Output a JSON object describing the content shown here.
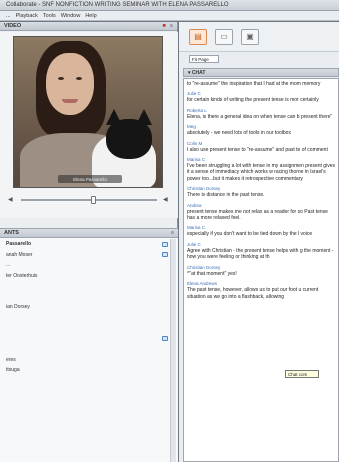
{
  "window": {
    "title": "Collaborate - SNF NONFICTION WRITING SEMINAR WITH ELENA PASSARELLO"
  },
  "menu": {
    "items": [
      "...",
      "Playback",
      "Tools",
      "Window",
      "Help"
    ]
  },
  "video_panel": {
    "title": "VIDEO",
    "caption": "Elena Passarello"
  },
  "attendees_panel": {
    "title": "ANTS",
    "rows": [
      {
        "name": "Passarello",
        "bold": true,
        "status": true
      },
      {
        "name": "anah Moser",
        "bold": false,
        "status": true
      },
      {
        "name": "...",
        "bold": false,
        "status": false
      },
      {
        "name": "ter Oosterhuis",
        "bold": false,
        "status": false
      },
      {
        "name": "",
        "bold": false,
        "status": false
      },
      {
        "name": "",
        "bold": false,
        "status": false
      },
      {
        "name": "ian Dorsey",
        "bold": false,
        "status": false
      },
      {
        "name": "",
        "bold": false,
        "status": false
      },
      {
        "name": "",
        "bold": false,
        "status": false
      },
      {
        "name": "",
        "bold": false,
        "status": true
      },
      {
        "name": "",
        "bold": false,
        "status": false
      },
      {
        "name": "eres",
        "bold": false,
        "status": false
      },
      {
        "name": "ttsuga",
        "bold": false,
        "status": false
      },
      {
        "name": "",
        "bold": false,
        "status": false
      },
      {
        "name": "",
        "bold": false,
        "status": false
      }
    ]
  },
  "toolbar": {
    "fit_label": "Fit Page"
  },
  "chat": {
    "title": "CHAT",
    "tooltip": "Chat com",
    "messages": [
      {
        "author": "",
        "text": "to \"re-assume\" the inspiration that I had at the mom memory"
      },
      {
        "author": "Julie C",
        "text": "for certain kinds of writing the present tense is mor certainly"
      },
      {
        "author": "Roberta L",
        "text": "Elena, is there a general idea on when tense can b present there\""
      },
      {
        "author": "Meg",
        "text": "absolutely - we need lots of tools in our toolbox"
      },
      {
        "author": "Colin M",
        "text": "I also use present tense to \"re-assume\" and past te of comment"
      },
      {
        "author": "Marisa C",
        "text": "I've been struggling a lot with tense in my assignmen present gives it a sense of immediacy which works w racing thorne in Israel's power too...but it makes it retrospective commentary"
      },
      {
        "author": "Christian Dorsey",
        "text": "There is distance in the past tense."
      },
      {
        "author": "Andrea",
        "text": "present tense makes me not relax as a reader for so Past tense has a more relaxed feel."
      },
      {
        "author": "Marisa C",
        "text": "especially if you don't want to be tied down by the l voice"
      },
      {
        "author": "Julie C",
        "text": "Agree with Christian - the present tense helps with g the moment - how you were feeling or thinking at th"
      },
      {
        "author": "Christian Dorsey",
        "text": "^\"at that moment\" yes!"
      },
      {
        "author": "Elena Andrews",
        "text": "The past tense, however, allows us to put our foot u current situation as we go into a flashback, allowing"
      }
    ]
  }
}
